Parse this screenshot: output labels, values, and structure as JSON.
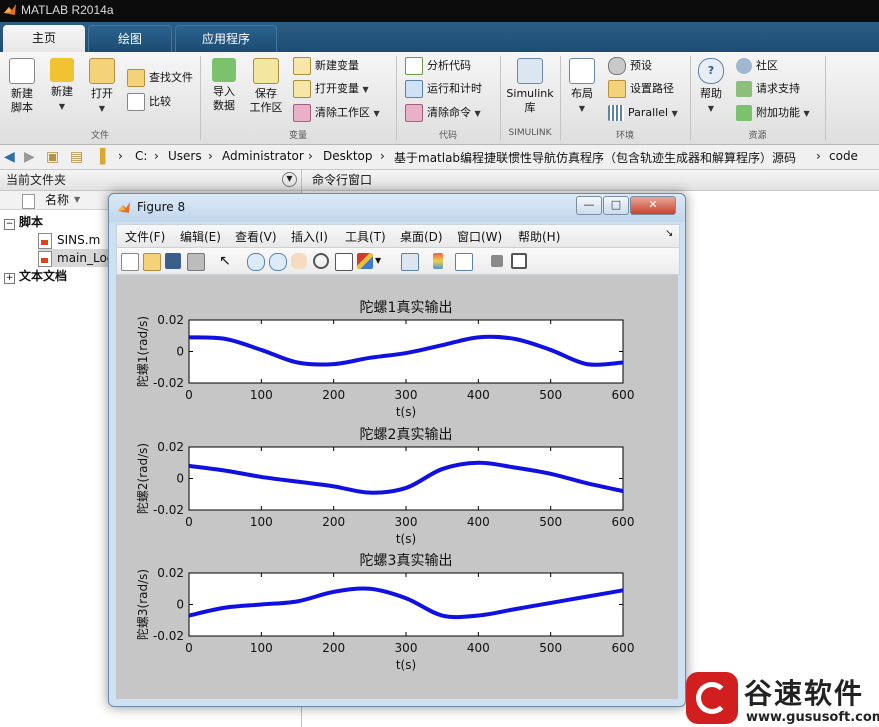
{
  "app": {
    "title": "MATLAB R2014a"
  },
  "tabs": [
    "主页",
    "绘图",
    "应用程序"
  ],
  "ribbon": {
    "new_script": "新建\n脚本",
    "new": "新建",
    "open": "打开",
    "find_files": "查找文件",
    "compare": "比较",
    "group_file": "文件",
    "import_data": "导入\n数据",
    "save_workspace": "保存\n工作区",
    "new_variable": "新建变量",
    "open_variable": "打开变量",
    "clear_workspace": "清除工作区",
    "group_variable": "变量",
    "analyze_code": "分析代码",
    "run_and_time": "运行和计时",
    "clear_commands": "清除命令",
    "group_code": "代码",
    "simulink_lib": "Simulink\n库",
    "group_simulink": "SIMULINK",
    "layout": "布局",
    "preferences": "预设",
    "set_path": "设置路径",
    "parallel": "Parallel",
    "group_env": "环境",
    "help": "帮助",
    "community": "社区",
    "request_support": "请求支持",
    "addons": "附加功能",
    "group_resources": "资源"
  },
  "address": {
    "crumbs": [
      "C:",
      "Users",
      "Administrator",
      "Desktop",
      "基于matlab编程捷联惯性导航仿真程序（包含轨迹生成器和解算程序）源码",
      "code"
    ]
  },
  "left_panel": {
    "title": "当前文件夹",
    "col_name": "名称",
    "tree": [
      {
        "label": "脚本",
        "type": "folder"
      },
      {
        "label": "SINS.m",
        "type": "file"
      },
      {
        "label": "main_Loc",
        "type": "file"
      },
      {
        "label": "文本文档",
        "type": "folder"
      }
    ]
  },
  "cmd_panel": {
    "title": "命令行窗口"
  },
  "figure": {
    "title": "Figure 8",
    "menu": [
      "文件(F)",
      "编辑(E)",
      "查看(V)",
      "插入(I)",
      "工具(T)",
      "桌面(D)",
      "窗口(W)",
      "帮助(H)"
    ],
    "line_color": "#1010e0"
  },
  "chart_data": [
    {
      "type": "line",
      "title": "陀螺1真实输出",
      "xlabel": "t(s)",
      "ylabel": "陀螺1(rad/s)",
      "xlim": [
        0,
        600
      ],
      "ylim": [
        -0.02,
        0.02
      ],
      "xticks": [
        0,
        100,
        200,
        300,
        400,
        500,
        600
      ],
      "yticks": [
        "0.02",
        "0",
        "-0.02"
      ],
      "x": [
        0,
        50,
        100,
        150,
        200,
        250,
        300,
        350,
        400,
        450,
        500,
        550,
        600
      ],
      "y": [
        0.009,
        0.008,
        0.001,
        -0.007,
        -0.008,
        -0.004,
        -0.001,
        0.004,
        0.009,
        0.008,
        0.001,
        -0.008,
        -0.007
      ]
    },
    {
      "type": "line",
      "title": "陀螺2真实输出",
      "xlabel": "t(s)",
      "ylabel": "陀螺2(rad/s)",
      "xlim": [
        0,
        600
      ],
      "ylim": [
        -0.02,
        0.02
      ],
      "xticks": [
        0,
        100,
        200,
        300,
        400,
        500,
        600
      ],
      "yticks": [
        "0.02",
        "0",
        "-0.02"
      ],
      "x": [
        0,
        50,
        100,
        150,
        200,
        250,
        300,
        350,
        400,
        450,
        500,
        550,
        600
      ],
      "y": [
        0.008,
        0.005,
        0.001,
        -0.002,
        -0.005,
        -0.009,
        -0.006,
        0.006,
        0.01,
        0.007,
        0.003,
        -0.003,
        -0.008
      ]
    },
    {
      "type": "line",
      "title": "陀螺3真实输出",
      "xlabel": "t(s)",
      "ylabel": "陀螺3(rad/s)",
      "xlim": [
        0,
        600
      ],
      "ylim": [
        -0.02,
        0.02
      ],
      "xticks": [
        0,
        100,
        200,
        300,
        400,
        500,
        600
      ],
      "yticks": [
        "0.02",
        "0",
        "-0.02"
      ],
      "x": [
        0,
        50,
        100,
        150,
        200,
        250,
        300,
        350,
        400,
        450,
        500,
        550,
        600
      ],
      "y": [
        -0.007,
        -0.002,
        0.0,
        0.002,
        0.008,
        0.01,
        0.004,
        -0.007,
        -0.007,
        -0.003,
        0.001,
        0.005,
        0.009
      ]
    }
  ],
  "watermark": {
    "brand": "谷速软件",
    "url": "www.gususoft.com"
  }
}
